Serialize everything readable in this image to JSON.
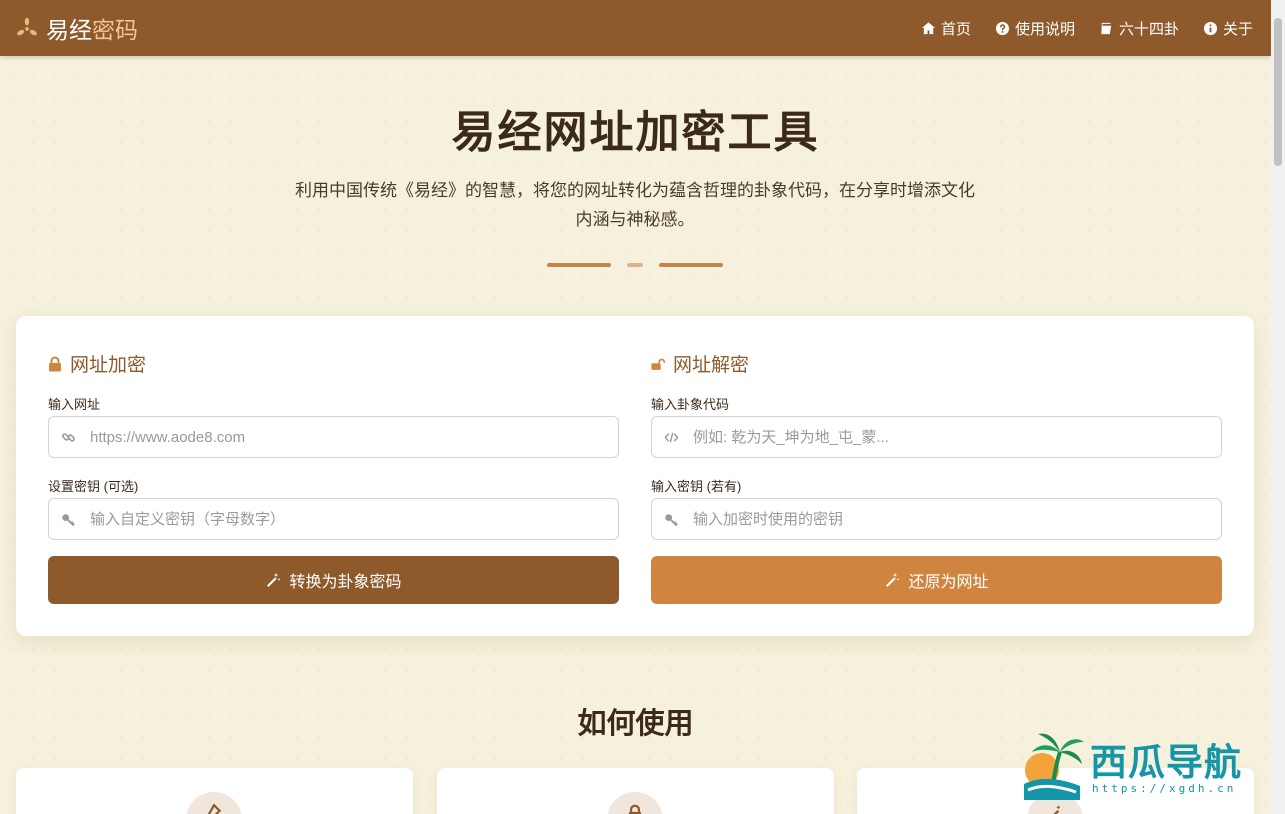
{
  "brand": {
    "name_a": "易经",
    "name_b": "密码",
    "icon": "yin-yang-sparkle-icon"
  },
  "nav": [
    {
      "label": "首页",
      "icon": "home-icon"
    },
    {
      "label": "使用说明",
      "icon": "question-circle-icon"
    },
    {
      "label": "六十四卦",
      "icon": "book-icon"
    },
    {
      "label": "关于",
      "icon": "info-circle-icon"
    }
  ],
  "hero": {
    "title": "易经网址加密工具",
    "subtitle": "利用中国传统《易经》的智慧，将您的网址转化为蕴含哲理的卦象代码，在分享时增添文化内涵与神秘感。"
  },
  "encrypt": {
    "title": "网址加密",
    "url_label": "输入网址",
    "url_placeholder": "https://www.aode8.com",
    "key_label": "设置密钥 (可选)",
    "key_placeholder": "输入自定义密钥（字母数字）",
    "button": "转换为卦象密码"
  },
  "decrypt": {
    "title": "网址解密",
    "code_label": "输入卦象代码",
    "code_placeholder": "例如: 乾为天_坤为地_屯_蒙...",
    "key_label": "输入密钥 (若有)",
    "key_placeholder": "输入加密时使用的密钥",
    "button": "还原为网址"
  },
  "how": {
    "title": "如何使用"
  },
  "watermark": {
    "text": "西瓜导航",
    "url": "https://xgdh.cn"
  },
  "colors": {
    "primary": "#8e5a2c",
    "accent": "#cf8540",
    "background": "#f6f1dc"
  }
}
